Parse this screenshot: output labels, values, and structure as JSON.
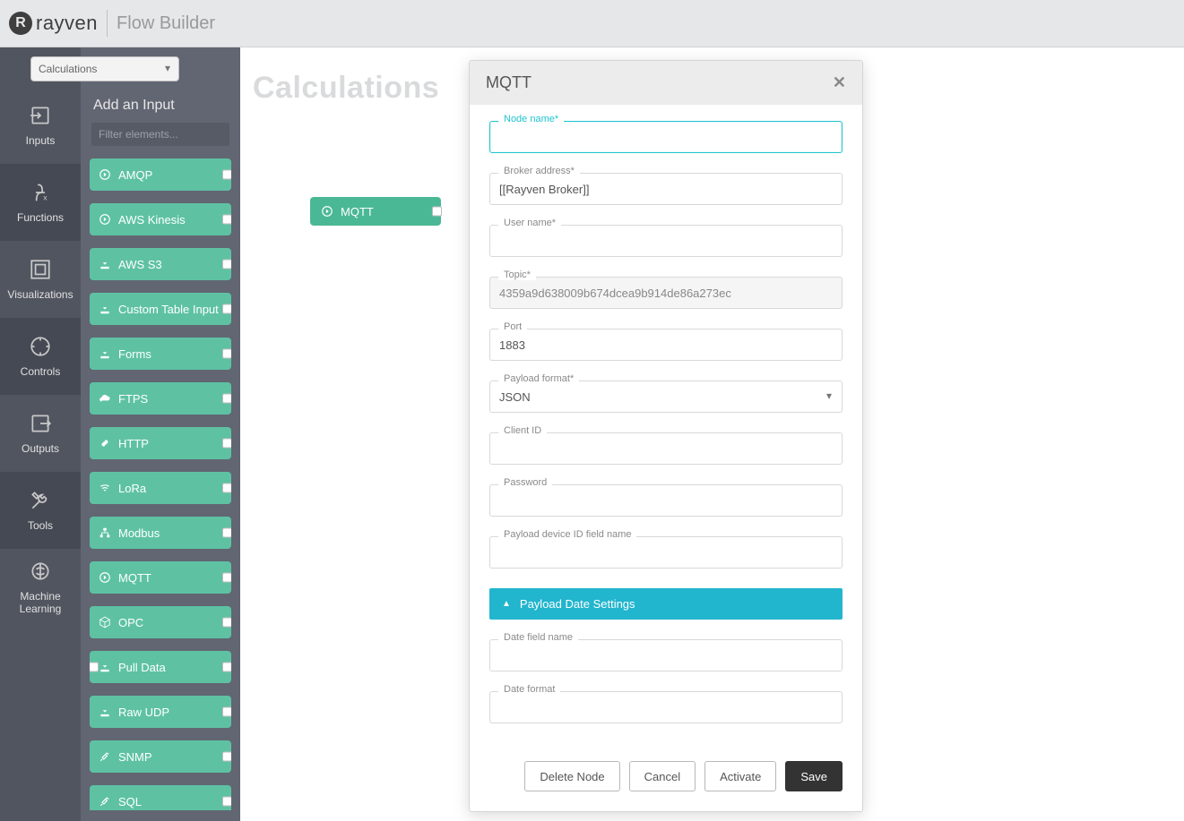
{
  "header": {
    "brand": "rayven",
    "app_title": "Flow Builder"
  },
  "top_dropdown": {
    "value": "Calculations"
  },
  "iconnav": [
    {
      "key": "inputs",
      "label": "Inputs"
    },
    {
      "key": "functions",
      "label": "Functions"
    },
    {
      "key": "visualizations",
      "label": "Visualizations"
    },
    {
      "key": "controls",
      "label": "Controls"
    },
    {
      "key": "outputs",
      "label": "Outputs"
    },
    {
      "key": "tools",
      "label": "Tools"
    },
    {
      "key": "ml",
      "label": "Machine Learning"
    }
  ],
  "sidebar": {
    "heading": "Add an Input",
    "filter_placeholder": "Filter elements...",
    "items": [
      {
        "label": "AMQP",
        "icon": "arrow-circle"
      },
      {
        "label": "AWS Kinesis",
        "icon": "arrow-circle"
      },
      {
        "label": "AWS S3",
        "icon": "download"
      },
      {
        "label": "Custom Table Input",
        "icon": "download"
      },
      {
        "label": "Forms",
        "icon": "download"
      },
      {
        "label": "FTPS",
        "icon": "cloud"
      },
      {
        "label": "HTTP",
        "icon": "link"
      },
      {
        "label": "LoRa",
        "icon": "wifi"
      },
      {
        "label": "Modbus",
        "icon": "sitemap"
      },
      {
        "label": "MQTT",
        "icon": "arrow-circle"
      },
      {
        "label": "OPC",
        "icon": "cube"
      },
      {
        "label": "Pull Data",
        "icon": "download",
        "left_port": true
      },
      {
        "label": "Raw UDP",
        "icon": "download"
      },
      {
        "label": "SNMP",
        "icon": "plug"
      },
      {
        "label": "SQL",
        "icon": "plug"
      }
    ]
  },
  "canvas": {
    "title": "Calculations",
    "node_label": "MQTT"
  },
  "modal": {
    "title": "MQTT",
    "fields": {
      "node_name": {
        "label": "Node name*",
        "value": ""
      },
      "broker_address": {
        "label": "Broker address*",
        "value": "[[Rayven Broker]]"
      },
      "user_name": {
        "label": "User name*",
        "value": ""
      },
      "topic": {
        "label": "Topic*",
        "value": "4359a9d638009b674dcea9b914de86a273ec"
      },
      "port": {
        "label": "Port",
        "value": "1883"
      },
      "payload_format": {
        "label": "Payload format*",
        "value": "JSON"
      },
      "client_id": {
        "label": "Client ID",
        "value": ""
      },
      "password": {
        "label": "Password",
        "value": ""
      },
      "payload_device_id": {
        "label": "Payload device ID field name",
        "value": ""
      },
      "date_field": {
        "label": "Date field name",
        "value": ""
      },
      "date_format": {
        "label": "Date format",
        "value": ""
      }
    },
    "accordion_label": "Payload Date Settings",
    "buttons": {
      "delete": "Delete Node",
      "cancel": "Cancel",
      "activate": "Activate",
      "save": "Save"
    }
  }
}
